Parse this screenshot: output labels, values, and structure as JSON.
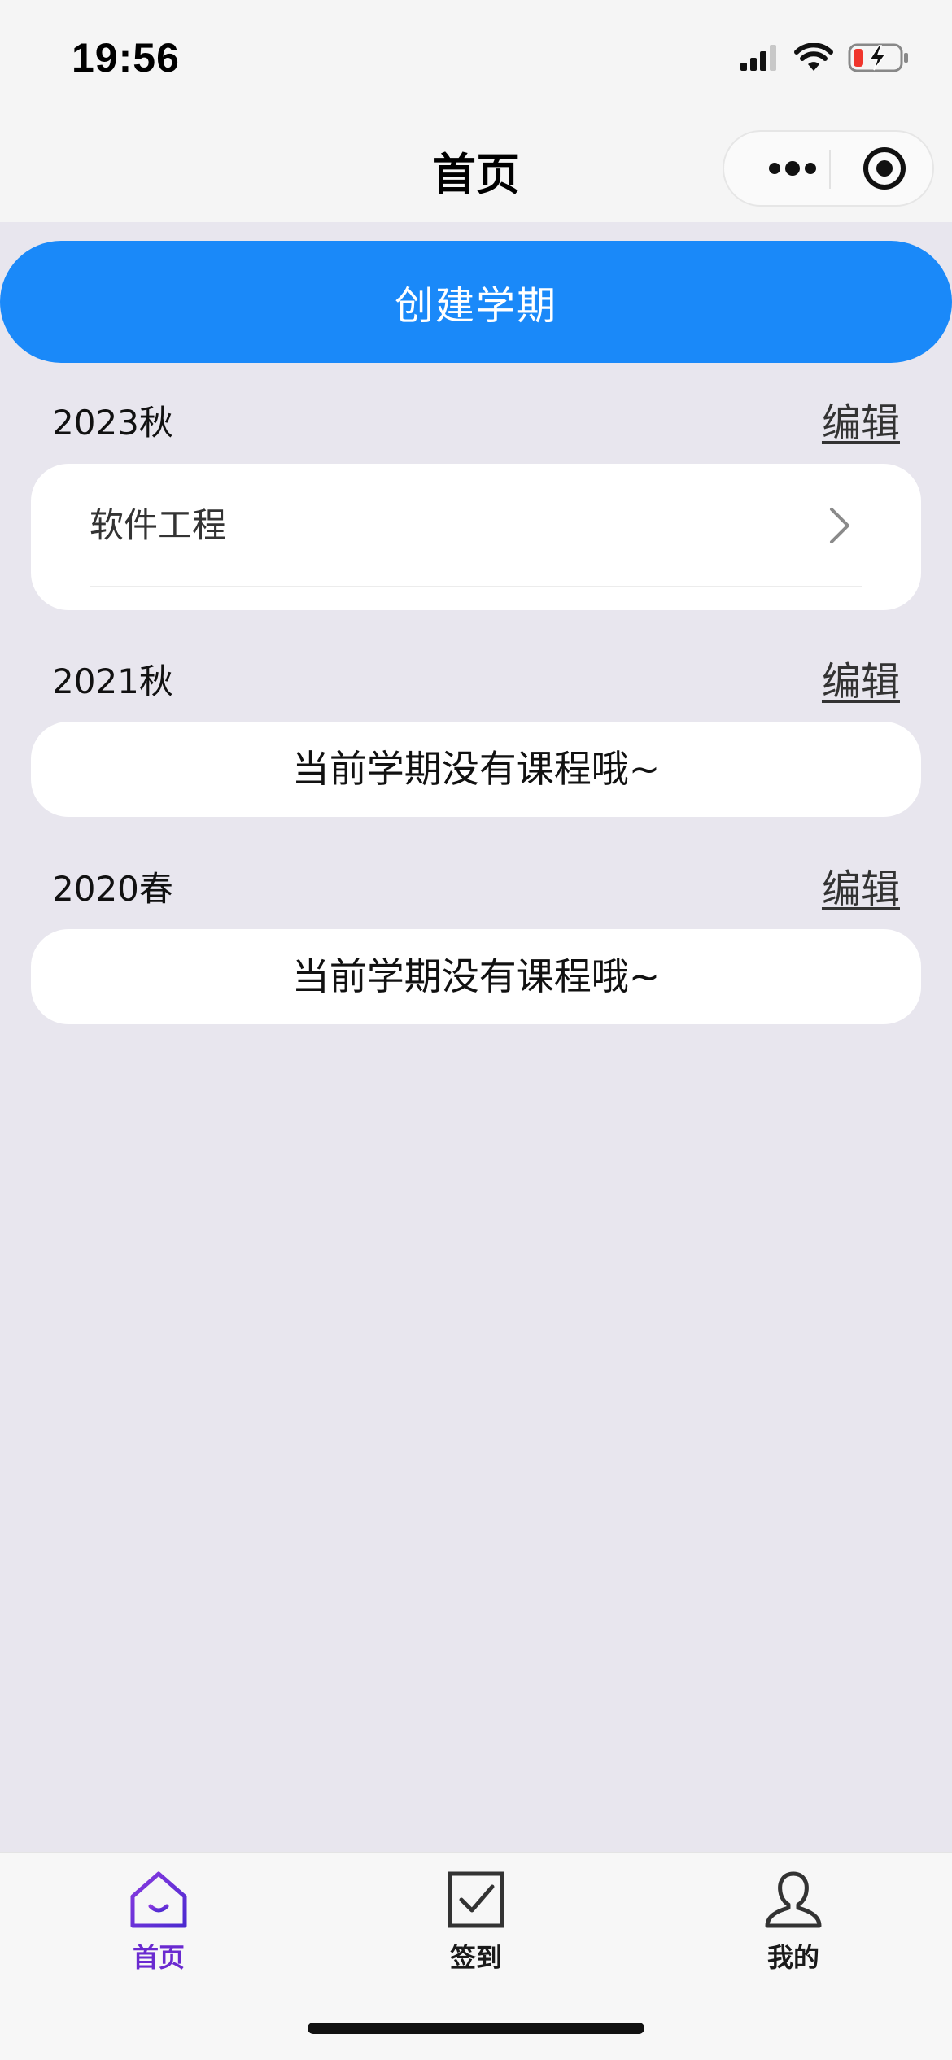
{
  "status_bar": {
    "time": "19:56",
    "icons": [
      "signal-icon",
      "wifi-icon",
      "battery-charging-icon"
    ]
  },
  "nav": {
    "title": "首页",
    "more_icon": "more-dots-icon",
    "close_icon": "target-circle-icon"
  },
  "main": {
    "create_label": "创建学期",
    "accent_color": "#1a89f9",
    "terms": [
      {
        "name": "2023秋",
        "edit_label": "编辑",
        "courses": [
          "软件工程"
        ]
      },
      {
        "name": "2021秋",
        "edit_label": "编辑",
        "empty_label": "当前学期没有课程哦~"
      },
      {
        "name": "2020春",
        "edit_label": "编辑",
        "empty_label": "当前学期没有课程哦~"
      }
    ]
  },
  "tab_bar": {
    "active_color": "#6a2ad0",
    "tabs": [
      {
        "label": "首页",
        "icon": "home-icon",
        "active": true
      },
      {
        "label": "签到",
        "icon": "checkbox-icon",
        "active": false
      },
      {
        "label": "我的",
        "icon": "user-icon",
        "active": false
      }
    ]
  }
}
